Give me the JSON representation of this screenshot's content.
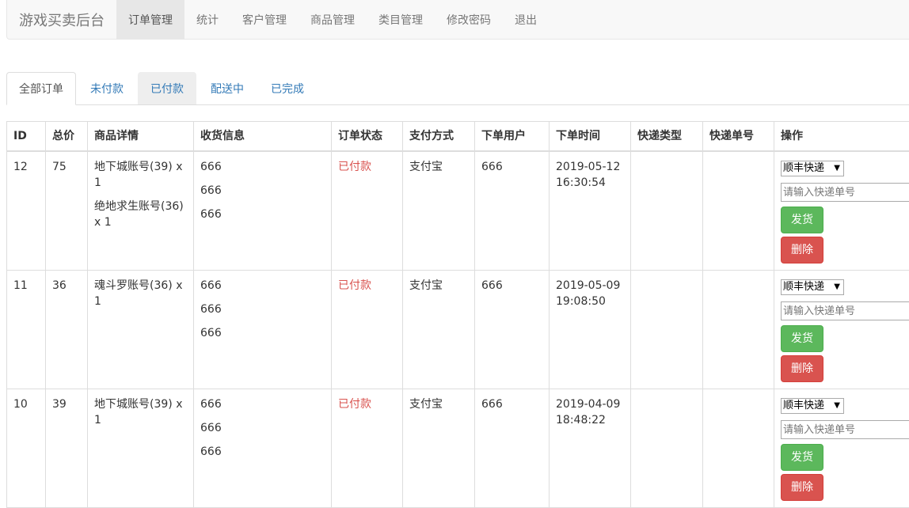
{
  "nav": {
    "brand": "游戏买卖后台",
    "items": [
      "订单管理",
      "统计",
      "客户管理",
      "商品管理",
      "类目管理",
      "修改密码",
      "退出"
    ]
  },
  "tabs": [
    "全部订单",
    "未付款",
    "已付款",
    "配送中",
    "已完成"
  ],
  "table": {
    "headers": [
      "ID",
      "总价",
      "商品详情",
      "收货信息",
      "订单状态",
      "支付方式",
      "下单用户",
      "下单时间",
      "快递类型",
      "快递单号",
      "操作"
    ],
    "rows": [
      {
        "id": "12",
        "total": "75",
        "products": [
          "地下城账号(39) x 1",
          "绝地求生账号(36) x 1"
        ],
        "shipping": [
          "666",
          "666",
          "666"
        ],
        "status": "已付款",
        "payment": "支付宝",
        "user": "666",
        "time": "2019-05-12 16:30:54",
        "express_type": "",
        "express_no": ""
      },
      {
        "id": "11",
        "total": "36",
        "products": [
          "魂斗罗账号(36) x 1"
        ],
        "shipping": [
          "666",
          "666",
          "666"
        ],
        "status": "已付款",
        "payment": "支付宝",
        "user": "666",
        "time": "2019-05-09 19:08:50",
        "express_type": "",
        "express_no": ""
      },
      {
        "id": "10",
        "total": "39",
        "products": [
          "地下城账号(39) x 1"
        ],
        "shipping": [
          "666",
          "666",
          "666"
        ],
        "status": "已付款",
        "payment": "支付宝",
        "user": "666",
        "time": "2019-04-09 18:48:22",
        "express_type": "",
        "express_no": ""
      }
    ],
    "ops": {
      "courier_selected": "顺丰快递",
      "tracking_placeholder": "请输入快递单号",
      "ship_label": "发货",
      "delete_label": "删除"
    }
  },
  "colors": {
    "status": "#d9534f",
    "ship_button": "#5cb85c",
    "delete_button": "#d9534f",
    "link": "#337ab7"
  }
}
